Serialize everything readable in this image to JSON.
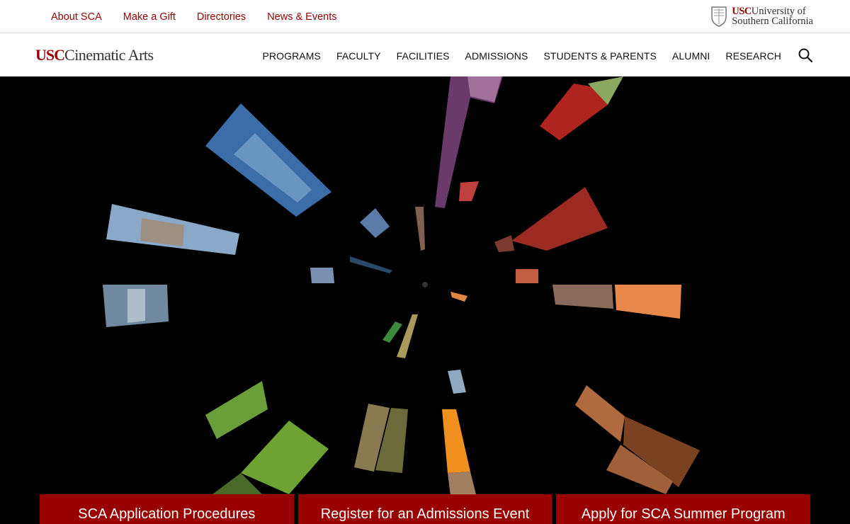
{
  "utility": {
    "links": [
      "About SCA",
      "Make a Gift",
      "Directories",
      "News & Events"
    ],
    "logo": {
      "usc": "USC",
      "line1": "University of",
      "line2": "Southern California"
    }
  },
  "brand": {
    "usc": "USC",
    "name": "Cinematic Arts"
  },
  "nav": {
    "items": [
      "PROGRAMS",
      "FACULTY",
      "FACILITIES",
      "ADMISSIONS",
      "STUDENTS & PARENTS",
      "ALUMNI",
      "RESEARCH"
    ],
    "search_icon": "search-icon"
  },
  "cta": [
    "SCA Application Procedures",
    "Register for an Admissions Event",
    "Apply for SCA Summer Program"
  ],
  "colors": {
    "brand_red": "#990000",
    "hero_bg": "#000000"
  }
}
